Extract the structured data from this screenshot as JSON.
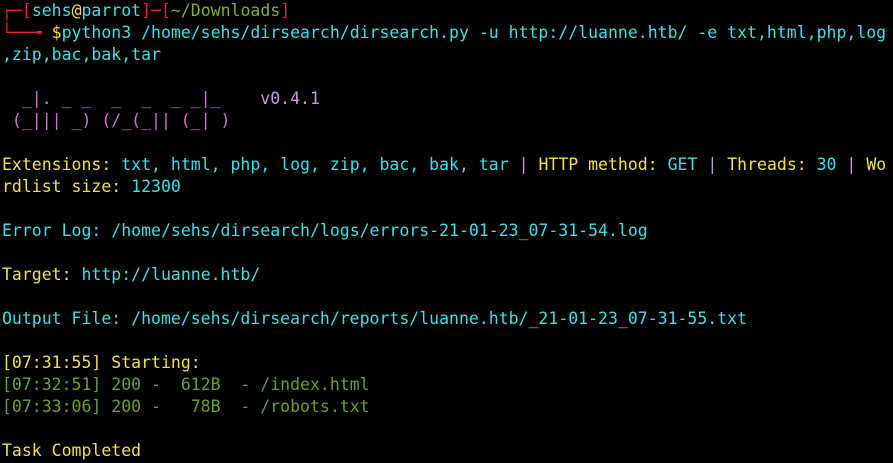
{
  "prompt": {
    "corner_top": "┌─",
    "open_bracket": "[",
    "user": "sehs",
    "at": "@",
    "host": "parrot",
    "close_bracket": "]",
    "sep": "─",
    "cwd_open": "[",
    "cwd": "~/Downloads",
    "cwd_close": "]",
    "corner_bottom": "└──╼ ",
    "dollar": "$",
    "command_part1": "python3 /home/sehs/dirsearch/dirsearch.py -u http://luanne.htb/ -e txt,html,php,log",
    "command_part2": ",zip,bac,bak,tar"
  },
  "banner": {
    "line1": "  _|. _ _  _  _  _ _|_    ",
    "version": "v0.4.1",
    "line2": " (_||| _) (/_(_|| (_| )"
  },
  "config": {
    "ext_label": "Extensions: ",
    "ext_value": "txt, html, php, log, zip, bac, bak, tar",
    "sep1": " | ",
    "method_label": "HTTP method: ",
    "method_value": "GET",
    "sep2": " | ",
    "threads_label": "Threads: ",
    "threads_value": "30",
    "sep3": " | ",
    "wordlist_label_part1": "Wo",
    "wordlist_label_part2": "rdlist size: ",
    "wordlist_value": "12300"
  },
  "error_log": {
    "label": "Error Log: ",
    "value": "/home/sehs/dirsearch/logs/errors-21-01-23_07-31-54.log"
  },
  "target": {
    "label": "Target: ",
    "value": "http://luanne.htb/"
  },
  "output_file": {
    "label": "Output File: ",
    "value": "/home/sehs/dirsearch/reports/luanne.htb/_21-01-23_07-31-55.txt"
  },
  "start": {
    "timestamp": "[07:31:55]",
    "text": " Starting:"
  },
  "results": [
    {
      "timestamp": "[07:32:51]",
      "text": " 200 -  612B  - /index.html"
    },
    {
      "timestamp": "[07:33:06]",
      "text": " 200 -   78B  - /robots.txt"
    }
  ],
  "task": {
    "text": "Task Completed"
  }
}
